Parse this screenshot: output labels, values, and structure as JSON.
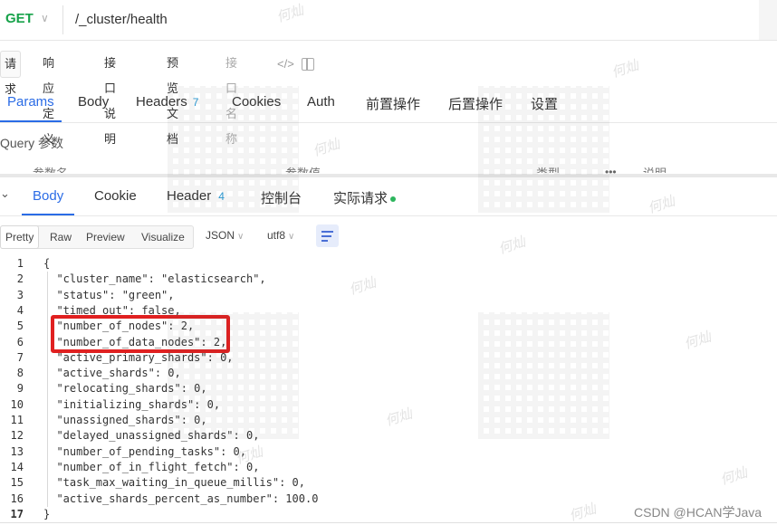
{
  "request": {
    "method": "GET",
    "url": "/_cluster/health"
  },
  "doc_tabs": [
    {
      "label": "请求",
      "active": true
    },
    {
      "label": "响应定义",
      "active": false
    },
    {
      "label": "接口说明",
      "active": false
    },
    {
      "label": "预览文档",
      "active": false
    },
    {
      "label": "接口名称",
      "active": false,
      "muted": true
    }
  ],
  "icons": {
    "code": "code-icon",
    "panel": "panel-icon",
    "chevron": "chevron-down-icon",
    "wrap": "wrap-lines-icon"
  },
  "req_tabs": [
    {
      "label": "Params",
      "active": true
    },
    {
      "label": "Body"
    },
    {
      "label": "Headers",
      "badge": "7"
    },
    {
      "label": "Cookies"
    },
    {
      "label": "Auth"
    },
    {
      "label": "前置操作"
    },
    {
      "label": "后置操作"
    },
    {
      "label": "设置"
    }
  ],
  "query_label": "Query 参数",
  "param_table_headers": [
    "参数名",
    "参数值",
    "类型",
    "说明"
  ],
  "more_dots": "•••",
  "resp_tabs": [
    {
      "label": "Body",
      "active": true
    },
    {
      "label": "Cookie"
    },
    {
      "label": "Header",
      "badge": "4"
    },
    {
      "label": "控制台"
    },
    {
      "label": "实际请求",
      "dot": true
    }
  ],
  "view_modes": [
    "Pretty",
    "Raw",
    "Preview",
    "Visualize"
  ],
  "format_select": "JSON",
  "encoding_select": "utf8",
  "code_lines": [
    "{",
    "  \"cluster_name\": \"elasticsearch\",",
    "  \"status\": \"green\",",
    "  \"timed_out\": false,",
    "  \"number_of_nodes\": 2,",
    "  \"number_of_data_nodes\": 2,",
    "  \"active_primary_shards\": 0,",
    "  \"active_shards\": 0,",
    "  \"relocating_shards\": 0,",
    "  \"initializing_shards\": 0,",
    "  \"unassigned_shards\": 0,",
    "  \"delayed_unassigned_shards\": 0,",
    "  \"number_of_pending_tasks\": 0,",
    "  \"number_of_in_flight_fetch\": 0,",
    "  \"task_max_waiting_in_queue_millis\": 0,",
    "  \"active_shards_percent_as_number\": 100.0",
    "}"
  ],
  "watermark_text": "何灿",
  "csdn_credit": "CSDN @HCAN学Java",
  "colors": {
    "accent": "#2b6ce6",
    "method": "#17a24a",
    "highlight": "#e02020"
  }
}
